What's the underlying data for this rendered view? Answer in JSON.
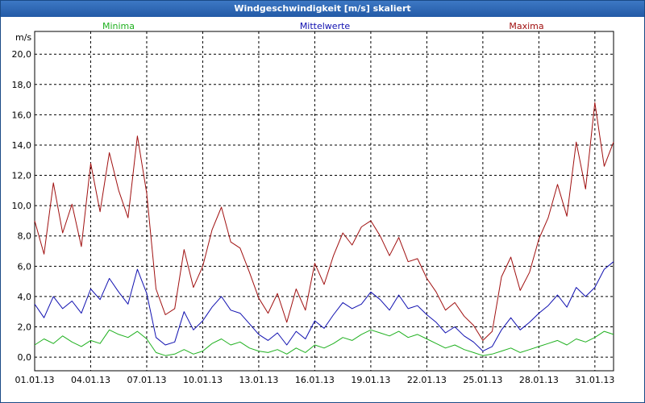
{
  "window": {
    "title": "Windgeschwindigkeit [m/s] skaliert"
  },
  "chart_data": {
    "type": "line",
    "ylabel": "m/s",
    "ylim": [
      -0.9,
      21.5
    ],
    "xlim": [
      0,
      31
    ],
    "yticks": [
      "0,0",
      "2,0",
      "4,0",
      "6,0",
      "8,0",
      "10,0",
      "12,0",
      "14,0",
      "16,0",
      "18,0",
      "20,0"
    ],
    "ytick_values": [
      0,
      2,
      4,
      6,
      8,
      10,
      12,
      14,
      16,
      18,
      20
    ],
    "xticks": [
      "01.01.13",
      "04.01.13",
      "07.01.13",
      "10.01.13",
      "13.01.13",
      "16.01.13",
      "19.01.13",
      "22.01.13",
      "25.01.13",
      "28.01.13",
      "31.01.13"
    ],
    "xtick_values": [
      0,
      3,
      6,
      9,
      12,
      15,
      18,
      21,
      24,
      27,
      30
    ],
    "grid": true,
    "legend": "top",
    "series": [
      {
        "name": "Minima",
        "color": "#1fb01f",
        "x": [
          0,
          0.5,
          1,
          1.5,
          2,
          2.5,
          3,
          3.5,
          4,
          4.5,
          5,
          5.5,
          6,
          6.5,
          7,
          7.5,
          8,
          8.5,
          9,
          9.5,
          10,
          10.5,
          11,
          11.5,
          12,
          12.5,
          13,
          13.5,
          14,
          14.5,
          15,
          15.5,
          16,
          16.5,
          17,
          17.5,
          18,
          18.5,
          19,
          19.5,
          20,
          20.5,
          21,
          21.5,
          22,
          22.5,
          23,
          23.5,
          24,
          24.5,
          25,
          25.5,
          26,
          26.5,
          27,
          27.5,
          28,
          28.5,
          29,
          29.5,
          30,
          30.5,
          31
        ],
        "values": [
          0.8,
          1.2,
          0.9,
          1.4,
          1.0,
          0.7,
          1.1,
          0.9,
          1.8,
          1.5,
          1.3,
          1.7,
          1.2,
          0.3,
          0.1,
          0.2,
          0.5,
          0.2,
          0.4,
          0.9,
          1.2,
          0.8,
          1.0,
          0.6,
          0.4,
          0.3,
          0.5,
          0.2,
          0.6,
          0.3,
          0.8,
          0.6,
          0.9,
          1.3,
          1.1,
          1.5,
          1.8,
          1.6,
          1.4,
          1.7,
          1.3,
          1.5,
          1.2,
          0.9,
          0.6,
          0.8,
          0.5,
          0.3,
          0.1,
          0.2,
          0.4,
          0.6,
          0.3,
          0.5,
          0.7,
          0.9,
          1.1,
          0.8,
          1.2,
          1.0,
          1.3,
          1.7,
          1.5
        ]
      },
      {
        "name": "Mittelwerte",
        "color": "#1010b0",
        "x": [
          0,
          0.5,
          1,
          1.5,
          2,
          2.5,
          3,
          3.5,
          4,
          4.5,
          5,
          5.5,
          6,
          6.5,
          7,
          7.5,
          8,
          8.5,
          9,
          9.5,
          10,
          10.5,
          11,
          11.5,
          12,
          12.5,
          13,
          13.5,
          14,
          14.5,
          15,
          15.5,
          16,
          16.5,
          17,
          17.5,
          18,
          18.5,
          19,
          19.5,
          20,
          20.5,
          21,
          21.5,
          22,
          22.5,
          23,
          23.5,
          24,
          24.5,
          25,
          25.5,
          26,
          26.5,
          27,
          27.5,
          28,
          28.5,
          29,
          29.5,
          30,
          30.5,
          31
        ],
        "values": [
          3.5,
          2.6,
          4.0,
          3.2,
          3.7,
          2.9,
          4.5,
          3.8,
          5.2,
          4.3,
          3.5,
          5.8,
          4.2,
          1.3,
          0.8,
          1.0,
          3.0,
          1.8,
          2.4,
          3.3,
          4.0,
          3.1,
          2.9,
          2.2,
          1.5,
          1.1,
          1.6,
          0.8,
          1.7,
          1.2,
          2.4,
          1.9,
          2.8,
          3.6,
          3.2,
          3.5,
          4.3,
          3.8,
          3.1,
          4.1,
          3.2,
          3.4,
          2.8,
          2.3,
          1.6,
          2.0,
          1.4,
          1.0,
          0.4,
          0.7,
          1.8,
          2.6,
          1.8,
          2.3,
          2.9,
          3.4,
          4.1,
          3.3,
          4.6,
          4.0,
          4.6,
          5.8,
          6.3
        ]
      },
      {
        "name": "Maxima",
        "color": "#a01010",
        "x": [
          0,
          0.5,
          1,
          1.5,
          2,
          2.5,
          3,
          3.5,
          4,
          4.5,
          5,
          5.5,
          6,
          6.5,
          7,
          7.5,
          8,
          8.5,
          9,
          9.5,
          10,
          10.5,
          11,
          11.5,
          12,
          12.5,
          13,
          13.5,
          14,
          14.5,
          15,
          15.5,
          16,
          16.5,
          17,
          17.5,
          18,
          18.5,
          19,
          19.5,
          20,
          20.5,
          21,
          21.5,
          22,
          22.5,
          23,
          23.5,
          24,
          24.5,
          25,
          25.5,
          26,
          26.5,
          27,
          27.5,
          28,
          28.5,
          29,
          29.5,
          30,
          30.5,
          31
        ],
        "values": [
          9.0,
          6.8,
          11.5,
          8.2,
          10.1,
          7.3,
          12.8,
          9.6,
          13.5,
          11.0,
          9.2,
          14.6,
          10.8,
          4.5,
          2.8,
          3.2,
          7.1,
          4.6,
          6.0,
          8.4,
          9.9,
          7.6,
          7.2,
          5.6,
          3.9,
          2.9,
          4.2,
          2.3,
          4.5,
          3.1,
          6.2,
          4.8,
          6.7,
          8.2,
          7.4,
          8.6,
          9.0,
          8.0,
          6.7,
          7.9,
          6.3,
          6.5,
          5.2,
          4.3,
          3.1,
          3.6,
          2.7,
          2.1,
          1.1,
          1.7,
          5.3,
          6.6,
          4.4,
          5.6,
          7.8,
          9.2,
          11.4,
          9.3,
          14.2,
          11.1,
          16.8,
          12.6,
          14.2
        ]
      }
    ]
  }
}
